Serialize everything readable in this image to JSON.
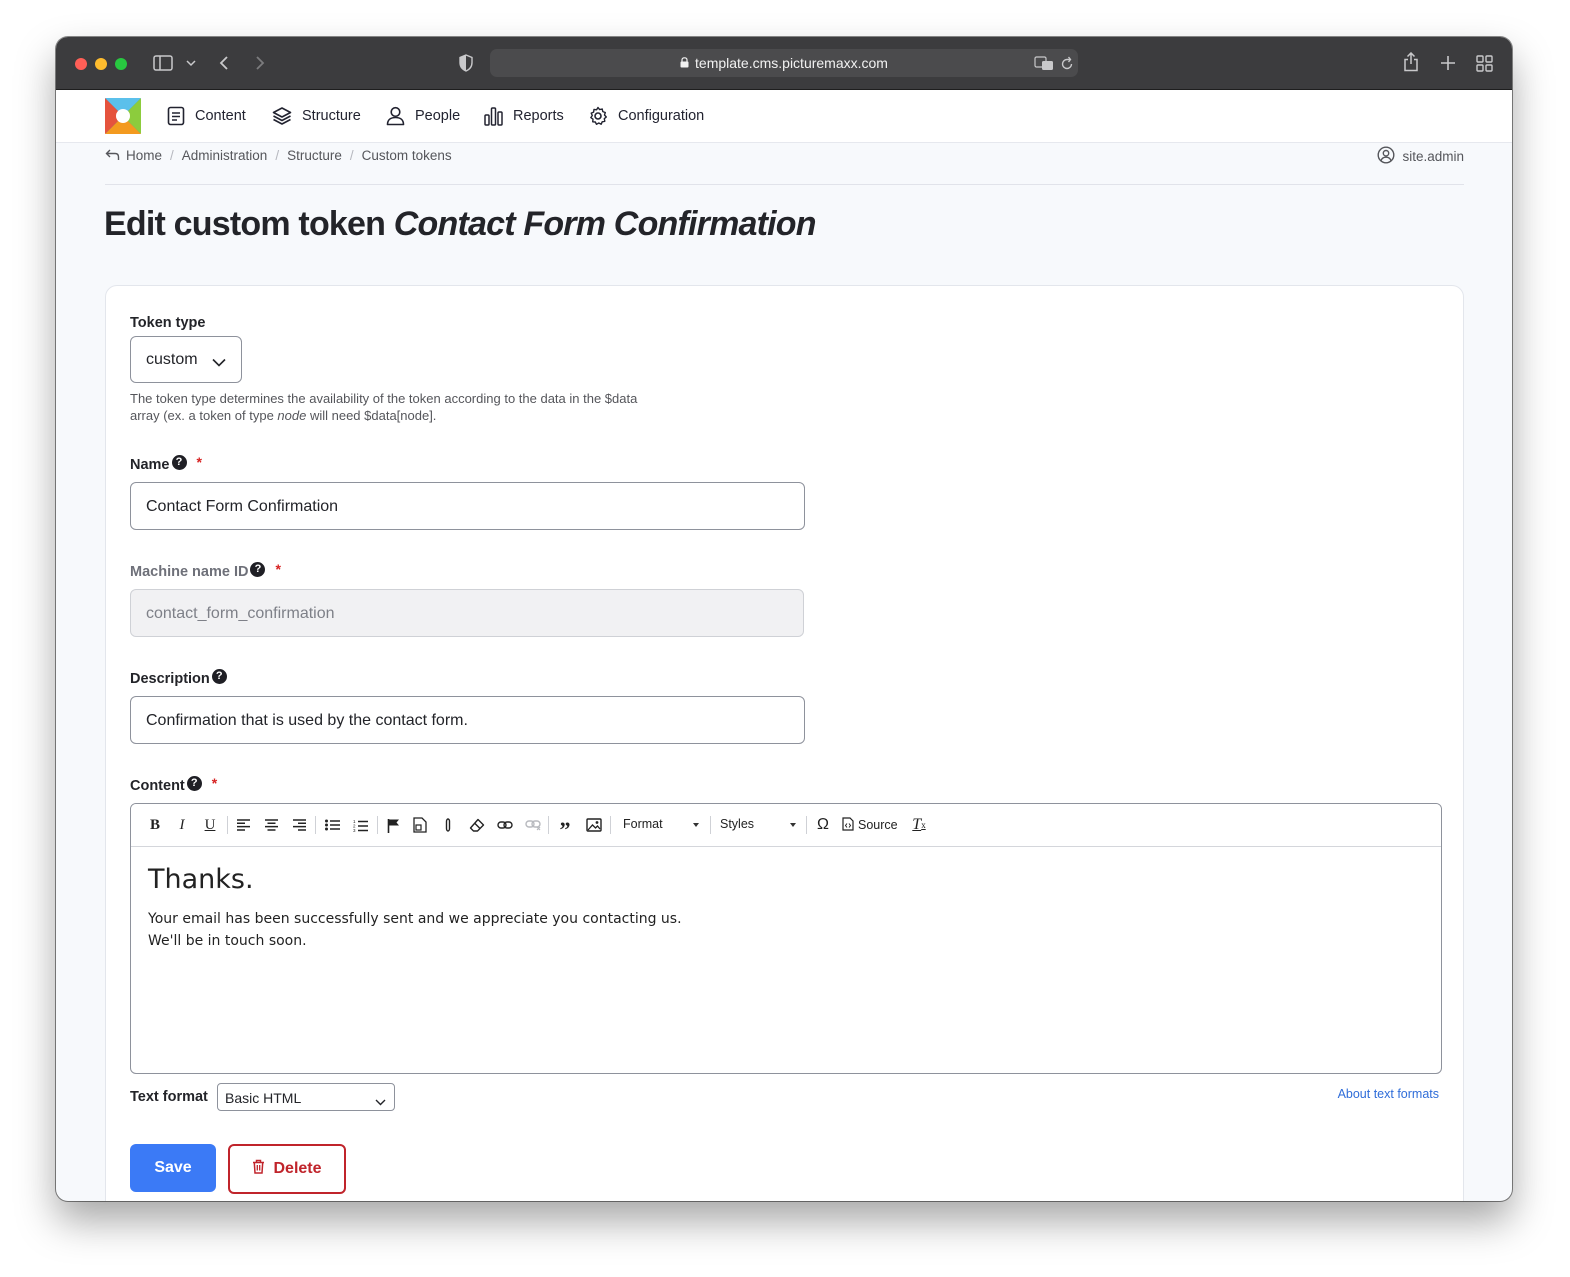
{
  "browser": {
    "url": "template.cms.picturemaxx.com"
  },
  "nav": {
    "items": [
      {
        "label": "Content",
        "icon": "document-icon"
      },
      {
        "label": "Structure",
        "icon": "layers-icon"
      },
      {
        "label": "People",
        "icon": "person-icon"
      },
      {
        "label": "Reports",
        "icon": "bar-chart-icon"
      },
      {
        "label": "Configuration",
        "icon": "gear-icon"
      }
    ]
  },
  "breadcrumb": [
    "Home",
    "Administration",
    "Structure",
    "Custom tokens"
  ],
  "user": {
    "name": "site.admin"
  },
  "page": {
    "title_prefix": "Edit custom token",
    "title_emphasis": "Contact Form Confirmation"
  },
  "form": {
    "token_type": {
      "label": "Token type",
      "value": "custom",
      "help_part1": "The token type determines the availability of the token according to the data in the $data array (ex. a token of type ",
      "help_em": "node",
      "help_part2": " will need $data[node]."
    },
    "name": {
      "label": "Name",
      "value": "Contact Form Confirmation",
      "required": "*"
    },
    "machine_name": {
      "label": "Machine name ID",
      "value": "contact_form_confirmation",
      "required": "*"
    },
    "description": {
      "label": "Description",
      "value": "Confirmation that is used by the contact form."
    },
    "content": {
      "label": "Content",
      "required": "*",
      "toolbar": {
        "format_label": "Format",
        "styles_label": "Styles",
        "source_label": "Source"
      },
      "heading": "Thanks.",
      "line1": "Your email has been successfully sent and we appreciate you contacting us.",
      "line2": "We'll be in touch soon."
    },
    "text_format": {
      "label": "Text format",
      "value": "Basic HTML",
      "about_link": "About text formats"
    },
    "buttons": {
      "save": "Save",
      "delete": "Delete"
    }
  },
  "colors": {
    "primary": "#3b7af6",
    "danger": "#c0242b",
    "link": "#2f6dd9",
    "required": "#d72222"
  }
}
